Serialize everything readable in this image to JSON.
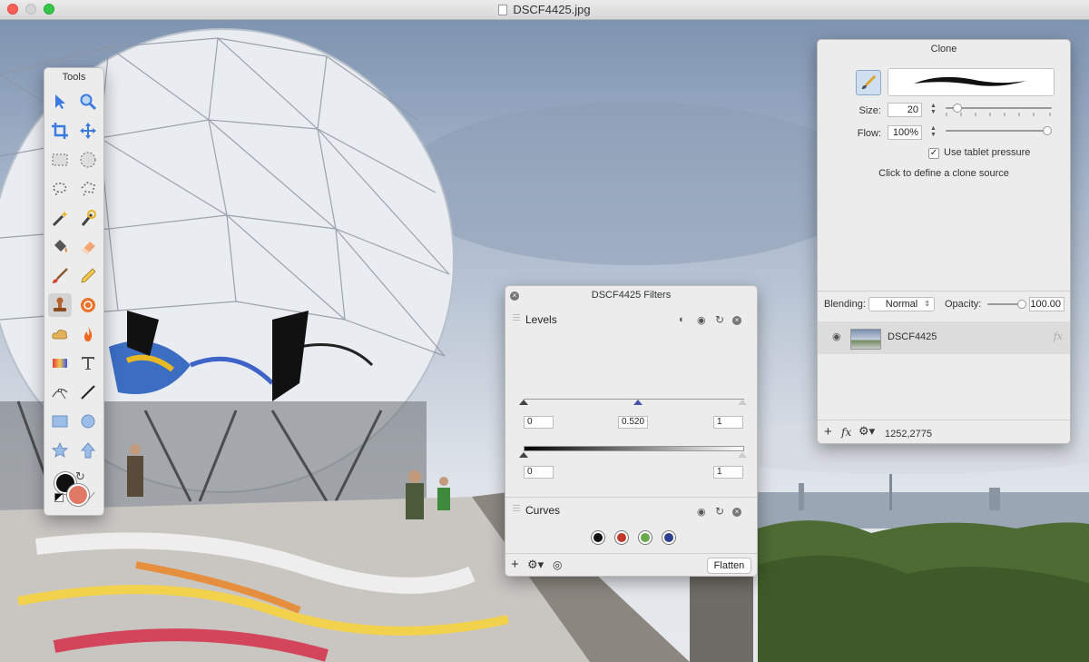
{
  "window": {
    "title": "DSCF4425.jpg"
  },
  "tools_panel": {
    "title": "Tools",
    "tools": [
      "arrow-select-tool",
      "zoom-tool",
      "crop-tool",
      "move-tool",
      "rect-select-tool",
      "ellipse-select-tool",
      "lasso-tool",
      "polygon-lasso-tool",
      "magic-wand-tool",
      "quick-select-tool",
      "paint-bucket-tool",
      "eraser-tool",
      "brush-tool",
      "pencil-tool",
      "clone-stamp-tool",
      "smudge-tool",
      "blur-tool",
      "burn-tool",
      "gradient-tool",
      "text-tool",
      "pen-tool",
      "line-tool",
      "rectangle-shape-tool",
      "ellipse-shape-tool",
      "star-shape-tool",
      "arrow-shape-tool"
    ],
    "selected_tool": "clone-stamp-tool",
    "foreground_color": "#111111",
    "background_color": "#e07a67"
  },
  "clone_panel": {
    "title": "Clone",
    "size_label": "Size:",
    "size_value": "20",
    "size_level": 0.12,
    "flow_label": "Flow:",
    "flow_value": "100%",
    "flow_level": 1.0,
    "tablet_pressure_label": "Use tablet pressure",
    "tablet_pressure_checked": true,
    "hint": "Click to define a clone source",
    "blending_label": "Blending:",
    "blending_value": "Normal",
    "opacity_label": "Opacity:",
    "opacity_value": "100.00",
    "opacity_level": 1.0,
    "layer_name": "DSCF4425",
    "coordinates": "1252,2775"
  },
  "filters_panel": {
    "title": "DSCF4425 Filters",
    "levels": {
      "title": "Levels",
      "input_black": "0",
      "input_gamma": "0.520",
      "input_white": "1",
      "output_black": "0",
      "output_white": "1"
    },
    "curves": {
      "title": "Curves",
      "channels": [
        "#111111",
        "#c0392b",
        "#6aa84f",
        "#2e3f8f"
      ]
    },
    "flatten_label": "Flatten"
  }
}
